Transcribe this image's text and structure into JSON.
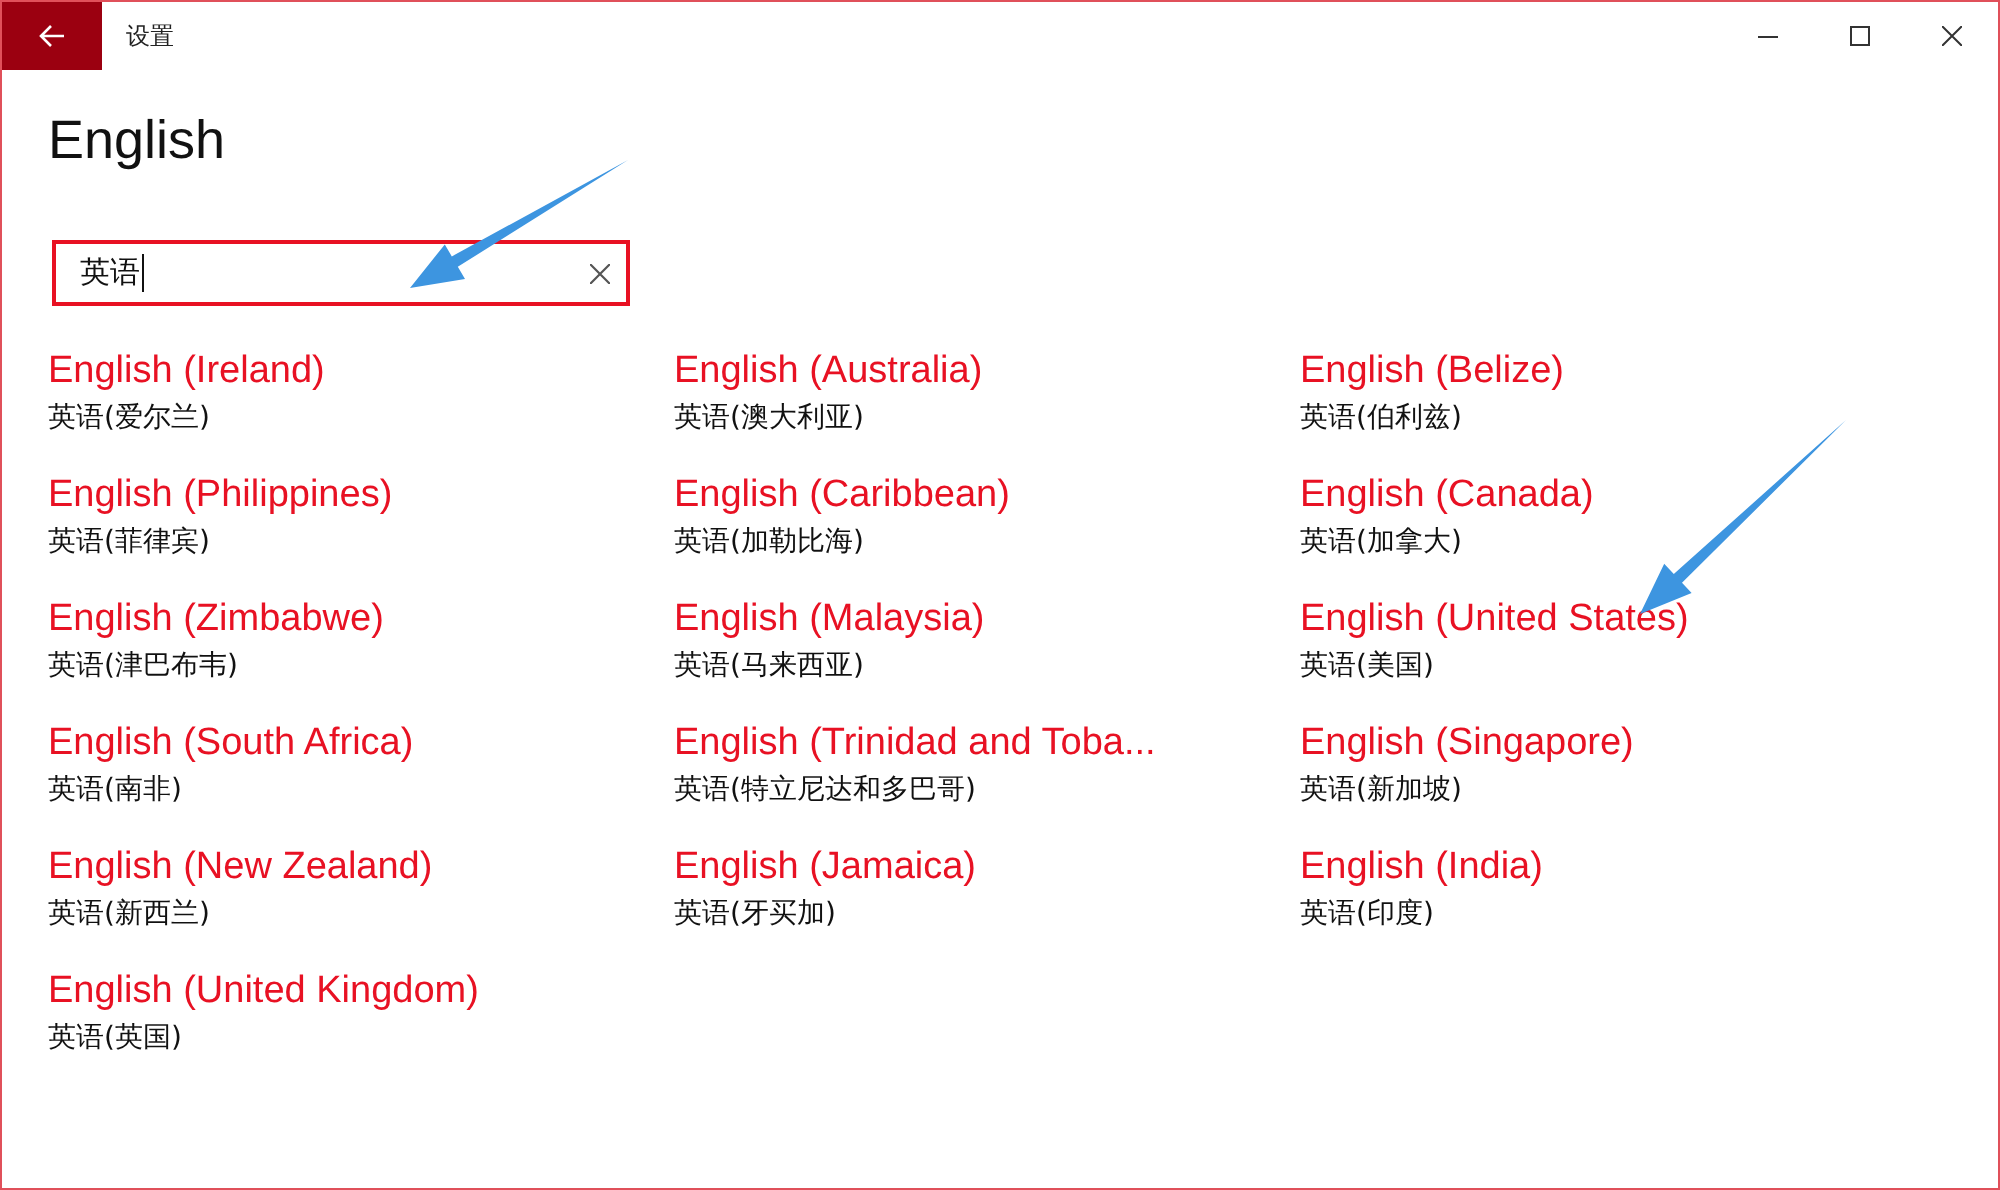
{
  "window": {
    "title": "设置"
  },
  "page": {
    "heading": "English"
  },
  "search": {
    "value": "英语"
  },
  "languages": [
    {
      "name": "English (Ireland)",
      "native": "英语(爱尔兰)"
    },
    {
      "name": "English (Australia)",
      "native": "英语(澳大利亚)"
    },
    {
      "name": "English (Belize)",
      "native": "英语(伯利兹)"
    },
    {
      "name": "English (Philippines)",
      "native": "英语(菲律宾)"
    },
    {
      "name": "English (Caribbean)",
      "native": "英语(加勒比海)"
    },
    {
      "name": "English (Canada)",
      "native": "英语(加拿大)"
    },
    {
      "name": "English (Zimbabwe)",
      "native": "英语(津巴布韦)"
    },
    {
      "name": "English (Malaysia)",
      "native": "英语(马来西亚)"
    },
    {
      "name": "English (United States)",
      "native": "英语(美国)"
    },
    {
      "name": "English (South Africa)",
      "native": "英语(南非)"
    },
    {
      "name": "English (Trinidad and Toba...",
      "native": "英语(特立尼达和多巴哥)"
    },
    {
      "name": "English (Singapore)",
      "native": "英语(新加坡)"
    },
    {
      "name": "English (New Zealand)",
      "native": "英语(新西兰)"
    },
    {
      "name": "English (Jamaica)",
      "native": "英语(牙买加)"
    },
    {
      "name": "English (India)",
      "native": "英语(印度)"
    },
    {
      "name": "English (United Kingdom)",
      "native": "英语(英国)"
    }
  ]
}
